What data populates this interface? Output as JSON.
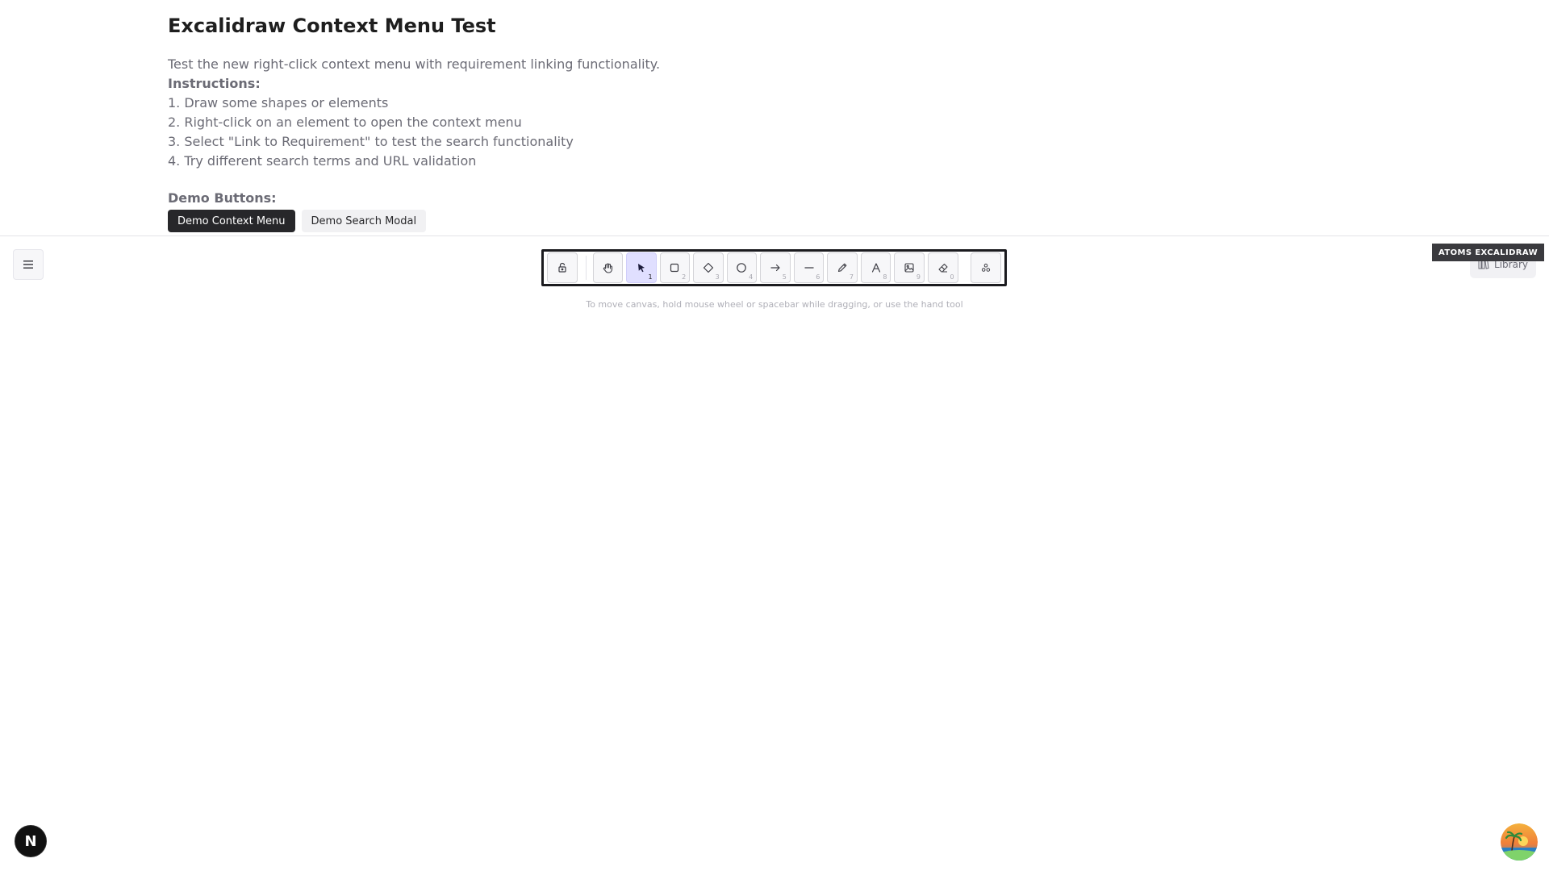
{
  "header": {
    "title": "Excalidraw Context Menu Test",
    "description": "Test the new right-click context menu with requirement linking functionality.",
    "instructions_heading": "Instructions:",
    "instructions": [
      "1. Draw some shapes or elements",
      "2. Right-click on an element to open the context menu",
      "3. Select \"Link to Requirement\" to test the search functionality",
      "4. Try different search terms and URL validation"
    ],
    "demo_heading": "Demo Buttons:",
    "demo_buttons": {
      "context_menu": "Demo Context Menu",
      "search_modal": "Demo Search Modal"
    }
  },
  "canvas": {
    "menu_icon": "hamburger-icon",
    "toolbar": {
      "tools": [
        {
          "name": "lock",
          "icon": "lock-icon",
          "key": ""
        },
        {
          "name": "hand",
          "icon": "hand-icon",
          "key": ""
        },
        {
          "name": "selection",
          "icon": "pointer-icon",
          "key": "1",
          "active": true
        },
        {
          "name": "rectangle",
          "icon": "rectangle-icon",
          "key": "2"
        },
        {
          "name": "diamond",
          "icon": "diamond-icon",
          "key": "3"
        },
        {
          "name": "ellipse",
          "icon": "ellipse-icon",
          "key": "4"
        },
        {
          "name": "arrow",
          "icon": "arrow-icon",
          "key": "5"
        },
        {
          "name": "line",
          "icon": "line-icon",
          "key": "6"
        },
        {
          "name": "draw",
          "icon": "pencil-icon",
          "key": "7"
        },
        {
          "name": "text",
          "icon": "text-icon",
          "key": "8"
        },
        {
          "name": "image",
          "icon": "image-icon",
          "key": "9"
        },
        {
          "name": "eraser",
          "icon": "eraser-icon",
          "key": "0"
        },
        {
          "name": "extra-tools",
          "icon": "shapes-icon",
          "key": ""
        }
      ]
    },
    "hint": "To move canvas, hold mouse wheel or spacebar while dragging, or use the hand tool",
    "library_label": "Library",
    "badge": "ATOMS EXCALIDRAW",
    "next_badge_letter": "N"
  },
  "colors": {
    "accent": "#e0dfff",
    "dark_button": "#27272a",
    "light_button": "#f1f1f3"
  }
}
